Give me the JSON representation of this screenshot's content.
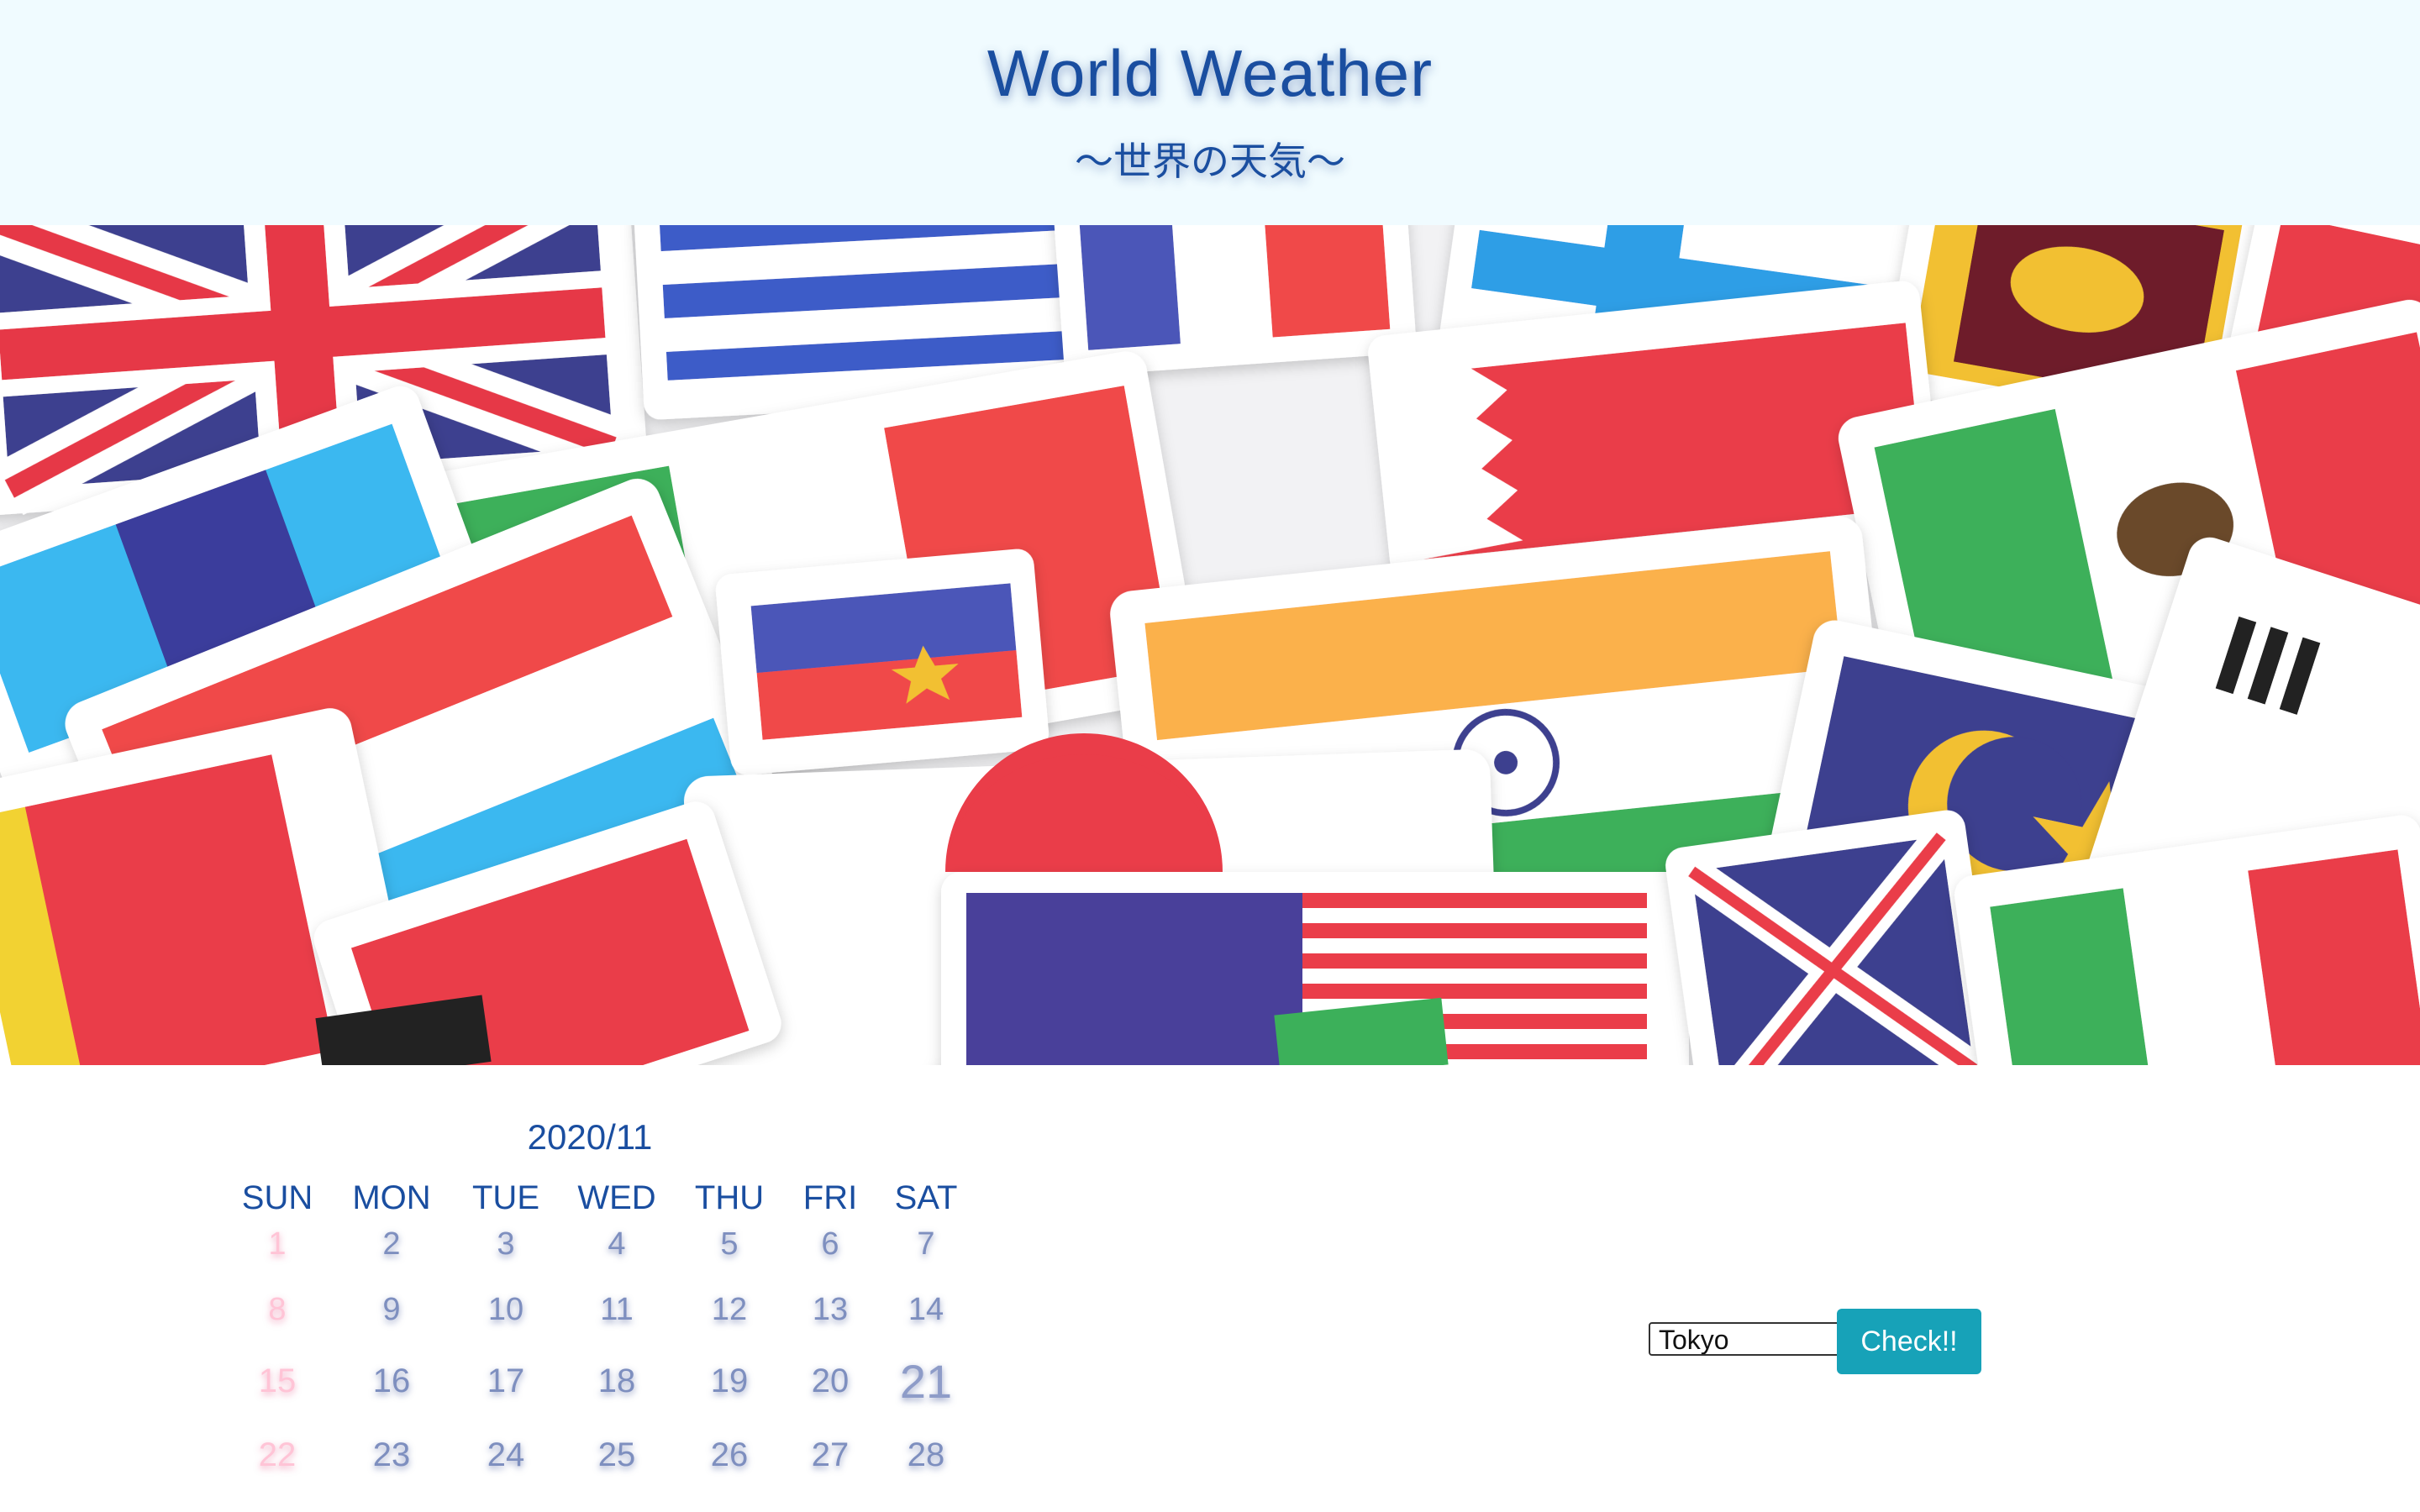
{
  "header": {
    "title": "World Weather",
    "subtitle": "〜世界の天気〜",
    "background": "#f0fbff",
    "title_color": "#1a4ea0"
  },
  "hero": {
    "image_description_icon": "flags-collage-image"
  },
  "calendar": {
    "title": "2020/11",
    "weekdays": [
      "SUN",
      "MON",
      "TUE",
      "WED",
      "THU",
      "FRI",
      "SAT"
    ],
    "weeks": [
      [
        "1",
        "2",
        "3",
        "4",
        "5",
        "6",
        "7"
      ],
      [
        "8",
        "9",
        "10",
        "11",
        "12",
        "13",
        "14"
      ],
      [
        "15",
        "16",
        "17",
        "18",
        "19",
        "20",
        "21"
      ],
      [
        "22",
        "23",
        "24",
        "25",
        "26",
        "27",
        "28"
      ]
    ],
    "today": "21",
    "sunday_color": "#ffc4d6",
    "day_color": "#7e8fbf"
  },
  "controls": {
    "city_selected": "Tokyo",
    "check_label": "Check!!",
    "button_color": "#17a2b8"
  }
}
